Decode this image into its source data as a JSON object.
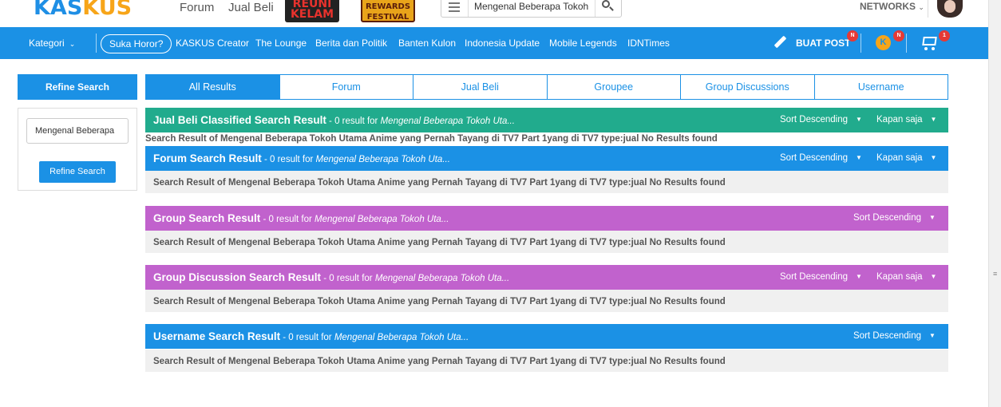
{
  "header": {
    "logo_kas": "KAS",
    "logo_kus": "KUS",
    "links": [
      "Forum",
      "Jual Beli"
    ],
    "promo1_line1": "REUNI",
    "promo1_line2": "KELAM",
    "promo2_line1": "REWARDS",
    "promo2_line2": "FESTIVAL",
    "search_value": "Mengenal Beberapa Tokoh",
    "networks_label": "NETWORKS"
  },
  "nav": {
    "kategori": "Kategori",
    "suka": "Suka Horor?",
    "items": [
      "KASKUS Creator",
      "The Lounge",
      "Berita dan Politik",
      "Banten Kulon",
      "Indonesia Update",
      "Mobile Legends",
      "IDNTimes"
    ],
    "buat_post": "BUAT POST",
    "badge_n": "N",
    "cart_count": "1"
  },
  "sidebar": {
    "title": "Refine Search",
    "input_value": "Mengenal Beberapa",
    "button": "Refine Search"
  },
  "tabs": [
    "All Results",
    "Forum",
    "Jual Beli",
    "Groupee",
    "Group Discussions",
    "Username"
  ],
  "results": {
    "jualbeli": {
      "title": "Jual Beli Classified Search Result",
      "count": " - 0 result for ",
      "query": "Mengenal Beberapa Tokoh Uta...",
      "sort": "Sort Descending",
      "time": "Kapan saja",
      "body": "Search Result of Mengenal Beberapa Tokoh Utama Anime yang Pernah Tayang di TV7 Part 1yang di TV7 type:jual No Results found"
    },
    "forum": {
      "title": "Forum Search Result",
      "count": " - 0 result for ",
      "query": "Mengenal Beberapa Tokoh Uta...",
      "sort": "Sort Descending",
      "time": "Kapan saja",
      "body": "Search Result of Mengenal Beberapa Tokoh Utama Anime yang Pernah Tayang di TV7 Part 1yang di TV7 type:jual No Results found"
    },
    "group": {
      "title": "Group Search Result",
      "count": " - 0 result for ",
      "query": "Mengenal Beberapa Tokoh Uta...",
      "sort": "Sort Descending",
      "body": "Search Result of Mengenal Beberapa Tokoh Utama Anime yang Pernah Tayang di TV7 Part 1yang di TV7 type:jual No Results found"
    },
    "groupdisc": {
      "title": "Group Discussion Search Result",
      "count": " - 0 result for ",
      "query": "Mengenal Beberapa Tokoh Uta...",
      "sort": "Sort Descending",
      "time": "Kapan saja",
      "body": "Search Result of Mengenal Beberapa Tokoh Utama Anime yang Pernah Tayang di TV7 Part 1yang di TV7 type:jual No Results found"
    },
    "username": {
      "title": "Username Search Result",
      "count": " - 0 result for ",
      "query": "Mengenal Beberapa Tokoh Uta...",
      "sort": "Sort Descending",
      "body": "Search Result of Mengenal Beberapa Tokoh Utama Anime yang Pernah Tayang di TV7 Part 1yang di TV7 type:jual No Results found"
    }
  },
  "colors": {
    "primary": "#1b91e5",
    "teal": "#21ab8d",
    "purple": "#c162cd",
    "accent": "#f7a519",
    "badge": "#e53935"
  },
  "icons": [
    "menu-icon",
    "search-icon",
    "chevron-down-icon",
    "pen-icon",
    "kaskus-chat-icon",
    "cart-icon",
    "caret-down-icon"
  ]
}
